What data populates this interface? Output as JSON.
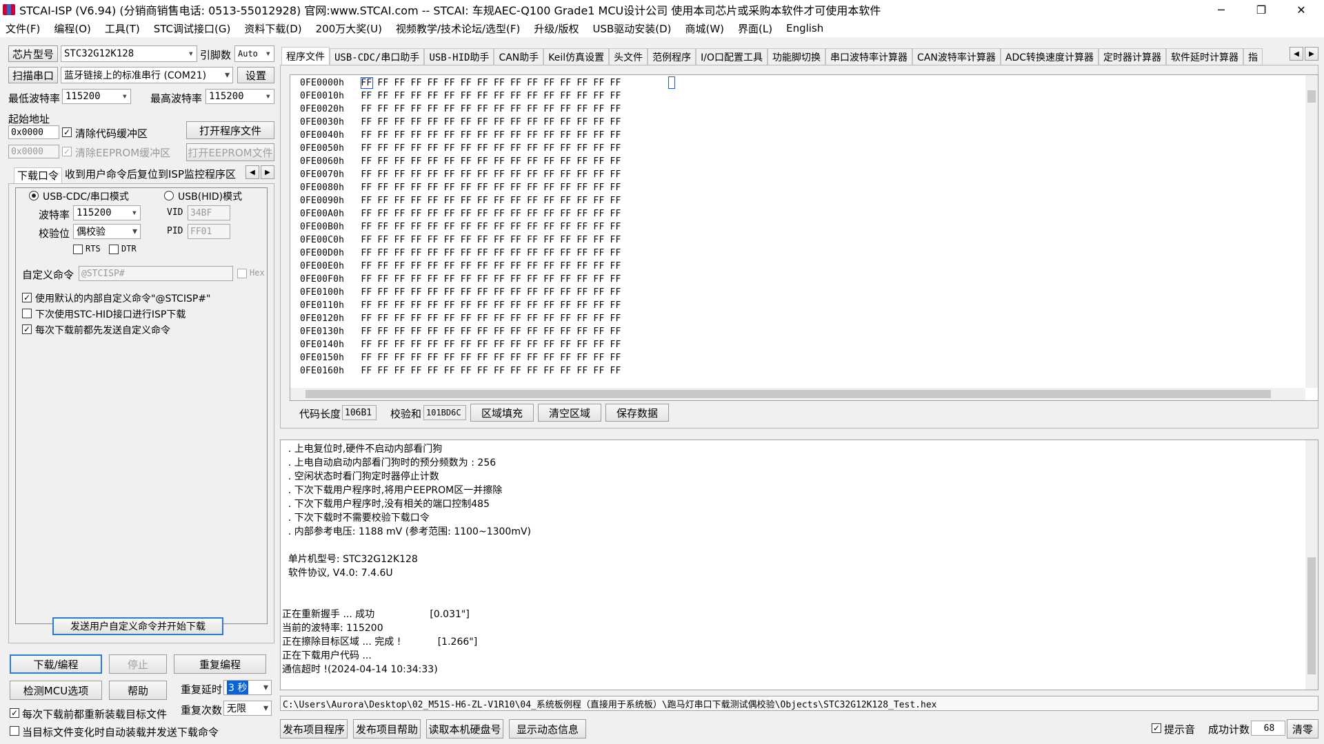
{
  "window": {
    "title": "STCAI-ISP (V6.94) (分销商销售电话: 0513-55012928) 官网:www.STCAI.com  -- STCAI: 车规AEC-Q100 Grade1 MCU设计公司 使用本司芯片或采购本软件才可使用本软件",
    "minimize": "─",
    "restore": "❐",
    "close": "✕"
  },
  "menu": [
    "文件(F)",
    "编程(O)",
    "工具(T)",
    "STC调试接口(G)",
    "资料下载(D)",
    "200万大奖(U)",
    "视频教学/技术论坛/选型(F)",
    "升级/版权",
    "USB驱动安装(D)",
    "商城(W)",
    "界面(L)",
    "English"
  ],
  "left": {
    "chip_btn": "芯片型号",
    "chip_value": "STC32G12K128",
    "pins_label": "引脚数",
    "pins_value": "Auto",
    "scan_btn": "扫描串口",
    "port_value": "蓝牙链接上的标准串行 (COM21)",
    "settings_btn": "设置",
    "min_baud_label": "最低波特率",
    "min_baud_value": "115200",
    "max_baud_label": "最高波特率",
    "max_baud_value": "115200",
    "start_addr_label": "起始地址",
    "addr1": "0x0000",
    "clear_code_label": "清除代码缓冲区",
    "open_prog_btn": "打开程序文件",
    "addr2": "0x0000",
    "clear_eeprom_label": "清除EEPROM缓冲区",
    "open_eeprom_btn": "打开EEPROM文件",
    "subtab1": "下载口令",
    "subtab2": "收到用户命令后复位到ISP监控程序区",
    "usb_cdc_label": "USB-CDC/串口模式",
    "usb_hid_label": "USB(HID)模式",
    "baud_label": "波特率",
    "baud_value": "115200",
    "parity_label": "校验位",
    "parity_value": "偶校验",
    "vid_label": "VID",
    "vid_value": "34BF",
    "pid_label": "PID",
    "pid_value": "FF01",
    "rts_label": "RTS",
    "dtr_label": "DTR",
    "custom_cmd_label": "自定义命令",
    "custom_cmd_value": "@STCISP#",
    "hex_label": "Hex",
    "opt1": "使用默认的内部自定义命令\"@STCISP#\"",
    "opt2": "下次使用STC-HID接口进行ISP下载",
    "opt3": "每次下载前都先发送自定义命令",
    "send_btn": "发送用户自定义命令并开始下载",
    "download_btn": "下载/编程",
    "stop_btn": "停止",
    "reprog_btn": "重复编程",
    "check_mcu_btn": "检测MCU选项",
    "help_btn": "帮助",
    "repeat_delay_label": "重复延时",
    "repeat_delay_value": "3 秒",
    "repeat_count_label": "重复次数",
    "repeat_count_value": "无限",
    "reload_label": "每次下载前都重新装载目标文件",
    "autoload_label": "当目标文件变化时自动装载并发送下载命令"
  },
  "tabs": [
    "程序文件",
    "USB-CDC/串口助手",
    "USB-HID助手",
    "CAN助手",
    "Keil仿真设置",
    "头文件",
    "范例程序",
    "I/O口配置工具",
    "功能脚切换",
    "串口波特率计算器",
    "CAN波特率计算器",
    "ADC转换速度计算器",
    "定时器计算器",
    "软件延时计算器",
    "指"
  ],
  "hex": {
    "addresses": [
      "0FE0000h",
      "0FE0010h",
      "0FE0020h",
      "0FE0030h",
      "0FE0040h",
      "0FE0050h",
      "0FE0060h",
      "0FE0070h",
      "0FE0080h",
      "0FE0090h",
      "0FE00A0h",
      "0FE00B0h",
      "0FE00C0h",
      "0FE00D0h",
      "0FE00E0h",
      "0FE00F0h",
      "0FE0100h",
      "0FE0110h",
      "0FE0120h",
      "0FE0130h",
      "0FE0140h",
      "0FE0150h",
      "0FE0160h"
    ],
    "bytes": "FF FF FF FF FF FF FF FF FF FF FF FF FF FF FF FF",
    "code_len_label": "代码长度",
    "code_len_value": "106B1",
    "checksum_label": "校验和",
    "checksum_value": "101BD6C",
    "fill_btn": "区域填充",
    "clear_btn": "清空区域",
    "save_btn": "保存数据"
  },
  "log": [
    "  . 上电复位时,硬件不启动内部看门狗",
    "  . 上电自动启动内部看门狗时的预分频数为 : 256",
    "  . 空闲状态时看门狗定时器停止计数",
    "  . 下次下载用户程序时,将用户EEPROM区一并擦除",
    "  . 下次下载用户程序时,没有相关的端口控制485",
    "  . 下次下载时不需要校验下载口令",
    "  . 内部参考电压: 1188 mV (参考范围: 1100~1300mV)",
    "",
    "  单片机型号: STC32G12K128",
    "  软件协议, V4.0: 7.4.6U",
    "",
    "",
    "正在重新握手 ... 成功                  [0.031\"]",
    "当前的波特率: 115200",
    "正在擦除目标区域 ... 完成 !            [1.266\"]",
    "正在下载用户代码 ...",
    "通信超时 !(2024-04-14 10:34:33)"
  ],
  "path": "C:\\Users\\Aurora\\Desktop\\02_M51S-H6-ZL-V1R10\\04_系统板例程（直接用于系统板）\\跑马灯串口下载测试偶校验\\Objects\\STC32G12K128_Test.hex",
  "bottom": {
    "publish_prog": "发布项目程序",
    "publish_help": "发布项目帮助",
    "read_disk": "读取本机硬盘号",
    "show_dynamic": "显示动态信息",
    "beep_label": "提示音",
    "success_label": "成功计数",
    "success_value": "68",
    "clear_btn": "清零"
  }
}
